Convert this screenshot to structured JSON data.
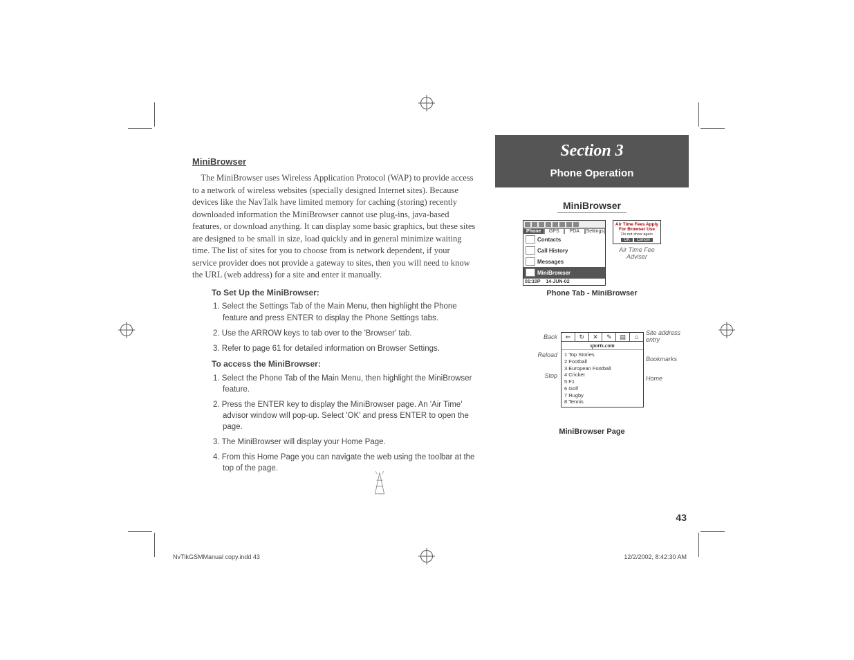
{
  "section": {
    "label": "Section 3",
    "subtitle": "Phone Operation"
  },
  "left": {
    "heading": "MiniBrowser",
    "intro": "The MiniBrowser uses Wireless Application Protocol (WAP) to provide access to a network of wireless websites (specially designed Internet sites). Because devices like the NavTalk have limited memory for caching (storing) recently downloaded information the MiniBrowser cannot use plug-ins, java-based features, or download anything. It can display some basic graphics, but these sites are designed to be small in size, load quickly and in general minimize waiting time.  The list of sites for you to choose from is network dependent, if your service provider does not provide a gateway to sites, then you will need to know the URL (web address) for a site and enter it manually.",
    "setup_heading": "To Set Up the MiniBrowser:",
    "setup_steps": [
      "1. Select the Settings Tab of the Main Menu, then highlight the Phone feature and press ENTER to display the Phone Settings tabs.",
      "2. Use the ARROW keys to tab over to the 'Browser' tab.",
      "3. Refer to page 61 for detailed information on Browser Settings."
    ],
    "access_heading": "To access the MiniBrowser:",
    "access_steps": [
      "1. Select the Phone Tab of the Main Menu, then highlight the MiniBrowser feature.",
      "2. Press the ENTER key to display the MiniBrowser page. An 'Air Time' advisor window will pop-up.  Select 'OK' and press ENTER to open the page.",
      "3. The MiniBrowser will display your Home Page.",
      "4. From this Home Page you can navigate the web using the toolbar at the top of the page."
    ]
  },
  "right": {
    "heading": "MiniBrowser",
    "phone_tabs": [
      "Phone",
      "GPS",
      "PDA",
      "Settings"
    ],
    "menu_items": [
      "Contacts",
      "Call History",
      "Messages",
      "MiniBrowser"
    ],
    "phone_time": "01:10P",
    "phone_date": "14-JUN-02",
    "fig1_caption": "Phone Tab - MiniBrowser",
    "adviser": {
      "line1": "Air Time Fees Apply For Browser Use",
      "line2": "Do not show again",
      "ok": "OK",
      "cancel": "Cancel",
      "caption": "Air Time Fee Adviser"
    },
    "browser": {
      "url": "sports.com",
      "items": [
        "1 Top Stories",
        "2 Football",
        "3 European Football",
        "4 Cricket",
        "5 F1",
        "6 Golf",
        "7 Rugby",
        "8 Tennis"
      ],
      "caption": "MiniBrowser Page",
      "callouts": {
        "back": "Back",
        "reload": "Reload",
        "stop": "Stop",
        "site": "Site address entry",
        "bookmarks": "Bookmarks",
        "home": "Home"
      }
    }
  },
  "page_number": "43",
  "footer": {
    "file": "NvTlkGSMManual copy.indd   43",
    "timestamp": "12/2/2002, 8:42:30 AM"
  }
}
